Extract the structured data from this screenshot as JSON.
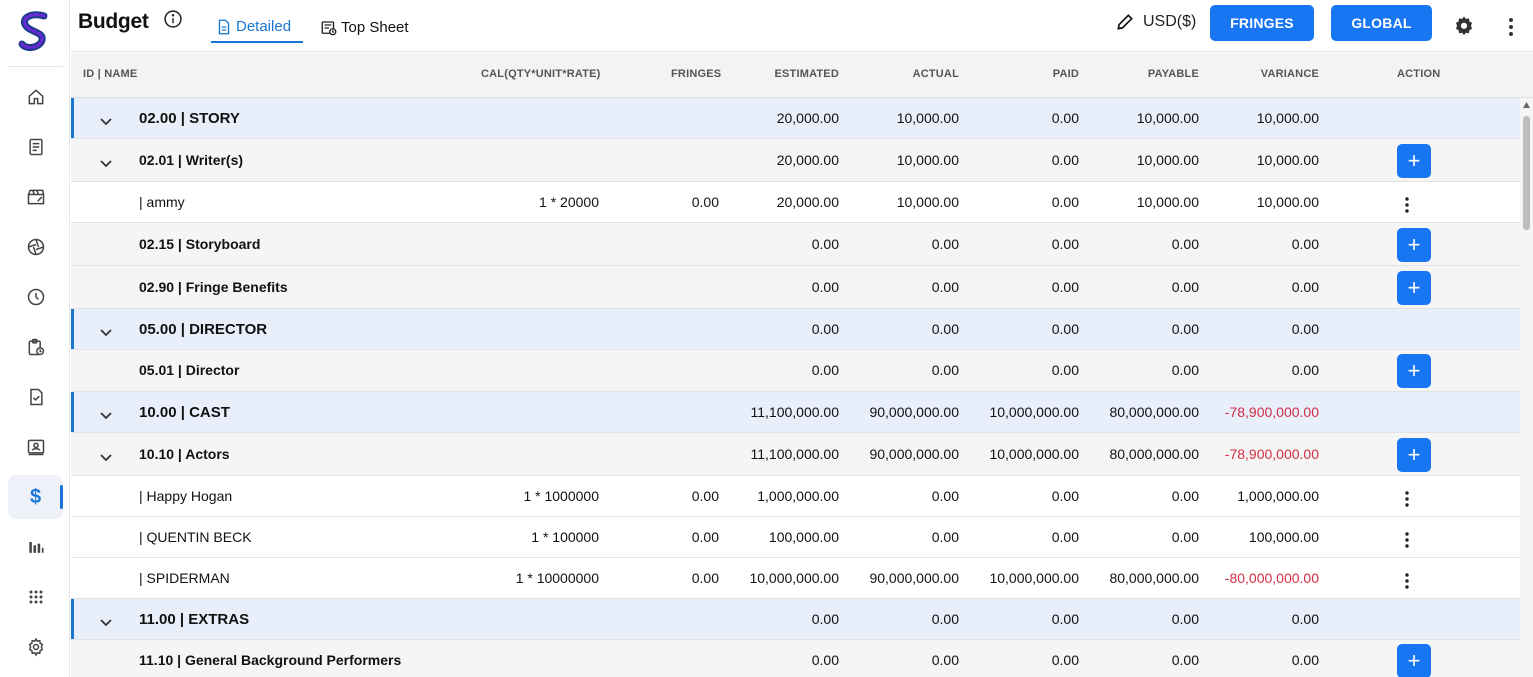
{
  "header": {
    "title": "Budget",
    "tabs": [
      {
        "label": "Detailed",
        "active": true
      },
      {
        "label": "Top Sheet",
        "active": false
      }
    ],
    "currency": "USD($)",
    "fringes_label": "FRINGES",
    "global_label": "GLOBAL"
  },
  "sidebar": {
    "items": [
      {
        "icon": "home-icon"
      },
      {
        "icon": "document-icon"
      },
      {
        "icon": "clapperboard-icon"
      },
      {
        "icon": "aperture-icon"
      },
      {
        "icon": "clock-icon"
      },
      {
        "icon": "clipboard-clock-icon"
      },
      {
        "icon": "file-check-icon"
      },
      {
        "icon": "contact-card-icon"
      },
      {
        "icon": "dollar-icon",
        "active": true,
        "glyph": "$"
      },
      {
        "icon": "bar-chart-icon"
      },
      {
        "icon": "apps-grid-icon"
      },
      {
        "icon": "settings-icon"
      }
    ]
  },
  "table": {
    "columns": [
      "ID | NAME",
      "CAL(QTY*UNIT*RATE)",
      "FRINGES",
      "ESTIMATED",
      "ACTUAL",
      "PAID",
      "PAYABLE",
      "VARIANCE",
      "ACTION"
    ],
    "rows": [
      {
        "type": "category",
        "expand": true,
        "name": "02.00 | STORY",
        "cal": "",
        "fringes": "",
        "estimated": "20,000.00",
        "actual": "10,000.00",
        "paid": "0.00",
        "payable": "10,000.00",
        "variance": "10,000.00",
        "negative": false,
        "action": "none"
      },
      {
        "type": "account",
        "expand": true,
        "name": "02.01 | Writer(s)",
        "cal": "",
        "fringes": "",
        "estimated": "20,000.00",
        "actual": "10,000.00",
        "paid": "0.00",
        "payable": "10,000.00",
        "variance": "10,000.00",
        "negative": false,
        "action": "add"
      },
      {
        "type": "detail",
        "expand": false,
        "name": "| ammy",
        "cal": "1 * 20000",
        "fringes": "0.00",
        "estimated": "20,000.00",
        "actual": "10,000.00",
        "paid": "0.00",
        "payable": "10,000.00",
        "variance": "10,000.00",
        "negative": false,
        "action": "more"
      },
      {
        "type": "account",
        "expand": false,
        "name": "02.15 | Storyboard",
        "cal": "",
        "fringes": "",
        "estimated": "0.00",
        "actual": "0.00",
        "paid": "0.00",
        "payable": "0.00",
        "variance": "0.00",
        "negative": false,
        "action": "add"
      },
      {
        "type": "account",
        "expand": false,
        "name": "02.90 | Fringe Benefits",
        "cal": "",
        "fringes": "",
        "estimated": "0.00",
        "actual": "0.00",
        "paid": "0.00",
        "payable": "0.00",
        "variance": "0.00",
        "negative": false,
        "action": "add"
      },
      {
        "type": "category",
        "expand": true,
        "name": "05.00 | DIRECTOR",
        "cal": "",
        "fringes": "",
        "estimated": "0.00",
        "actual": "0.00",
        "paid": "0.00",
        "payable": "0.00",
        "variance": "0.00",
        "negative": false,
        "action": "none"
      },
      {
        "type": "account",
        "expand": false,
        "name": "05.01 | Director",
        "cal": "",
        "fringes": "",
        "estimated": "0.00",
        "actual": "0.00",
        "paid": "0.00",
        "payable": "0.00",
        "variance": "0.00",
        "negative": false,
        "action": "add"
      },
      {
        "type": "category",
        "expand": true,
        "name": "10.00 | CAST",
        "cal": "",
        "fringes": "",
        "estimated": "11,100,000.00",
        "actual": "90,000,000.00",
        "paid": "10,000,000.00",
        "payable": "80,000,000.00",
        "variance": "-78,900,000.00",
        "negative": true,
        "action": "none"
      },
      {
        "type": "account",
        "expand": true,
        "name": "10.10 | Actors",
        "cal": "",
        "fringes": "",
        "estimated": "11,100,000.00",
        "actual": "90,000,000.00",
        "paid": "10,000,000.00",
        "payable": "80,000,000.00",
        "variance": "-78,900,000.00",
        "negative": true,
        "action": "add"
      },
      {
        "type": "detail",
        "expand": false,
        "name": "| Happy Hogan",
        "cal": "1 * 1000000",
        "fringes": "0.00",
        "estimated": "1,000,000.00",
        "actual": "0.00",
        "paid": "0.00",
        "payable": "0.00",
        "variance": "1,000,000.00",
        "negative": false,
        "action": "more"
      },
      {
        "type": "detail",
        "expand": false,
        "name": "| QUENTIN BECK",
        "cal": "1 * 100000",
        "fringes": "0.00",
        "estimated": "100,000.00",
        "actual": "0.00",
        "paid": "0.00",
        "payable": "0.00",
        "variance": "100,000.00",
        "negative": false,
        "action": "more"
      },
      {
        "type": "detail",
        "expand": false,
        "name": "| SPIDERMAN",
        "cal": "1 * 10000000",
        "fringes": "0.00",
        "estimated": "10,000,000.00",
        "actual": "90,000,000.00",
        "paid": "10,000,000.00",
        "payable": "80,000,000.00",
        "variance": "-80,000,000.00",
        "negative": true,
        "action": "more"
      },
      {
        "type": "category",
        "expand": true,
        "name": "11.00 | EXTRAS",
        "cal": "",
        "fringes": "",
        "estimated": "0.00",
        "actual": "0.00",
        "paid": "0.00",
        "payable": "0.00",
        "variance": "0.00",
        "negative": false,
        "action": "none"
      },
      {
        "type": "account",
        "expand": false,
        "name": "11.10 | General Background Performers",
        "cal": "",
        "fringes": "",
        "estimated": "0.00",
        "actual": "0.00",
        "paid": "0.00",
        "payable": "0.00",
        "variance": "0.00",
        "negative": false,
        "action": "add"
      }
    ]
  },
  "colors": {
    "accent": "#1976f2",
    "category_bg": "#e8eefa",
    "account_bg": "#f5f5f5",
    "negative": "#d32f44"
  }
}
